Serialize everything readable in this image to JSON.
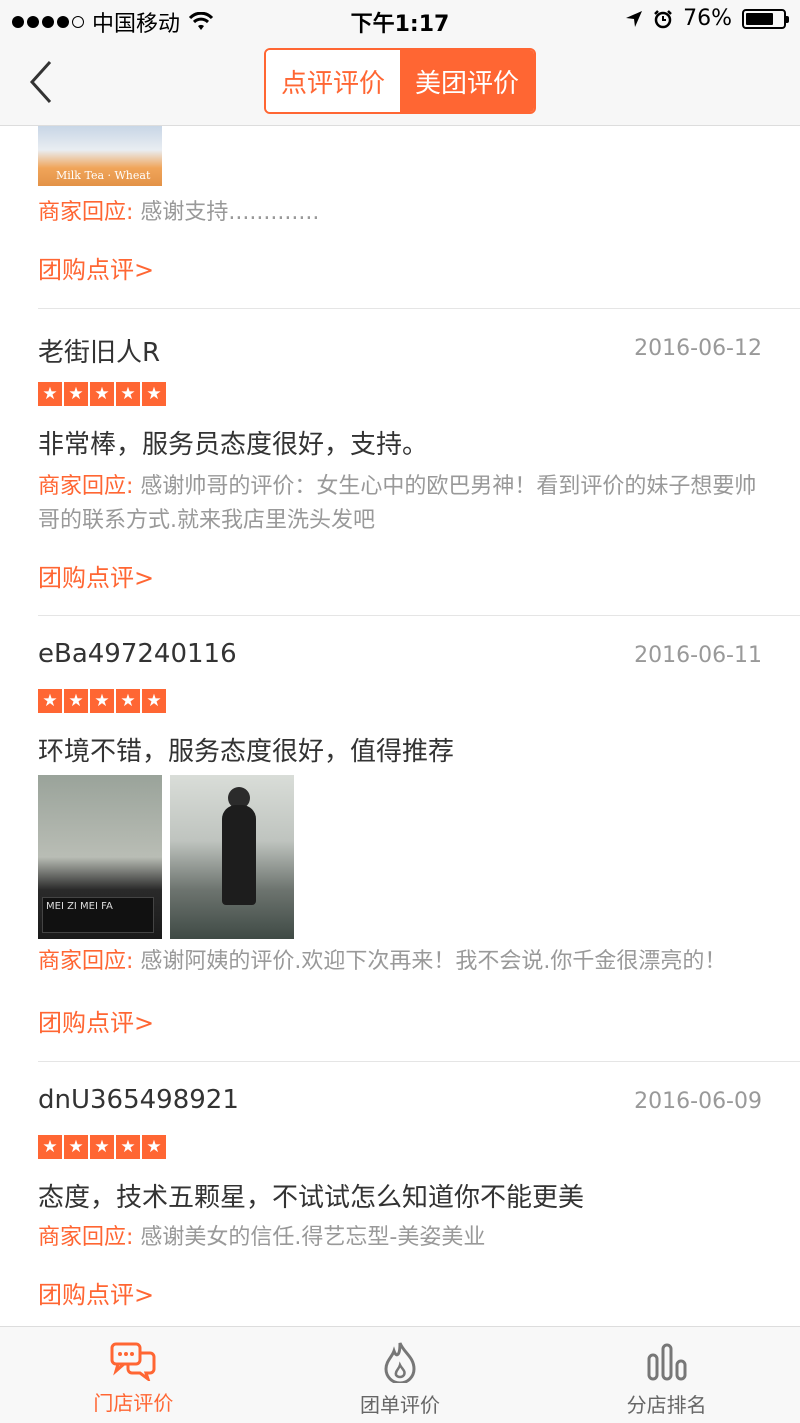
{
  "status_bar": {
    "carrier": "中国移动",
    "time": "下午1:17",
    "battery_percent": "76%",
    "battery_level": 0.76
  },
  "nav": {
    "back_icon": "chevron-left-icon",
    "segments": [
      {
        "label": "点评评价",
        "active": false
      },
      {
        "label": "美团评价",
        "active": true
      }
    ]
  },
  "previous_review": {
    "reply_label": "商家回应:",
    "reply_text": " 感谢支持.............",
    "link": "团购点评>"
  },
  "reviews": [
    {
      "user": "老街旧人R",
      "date": "2016-06-12",
      "rating": 5,
      "text": "非常棒，服务员态度很好，支持。",
      "reply_label": "商家回应:",
      "reply_text": " 感谢帅哥的评价：女生心中的欧巴男神！看到评价的妹子想要帅哥的联系方式.就来我店里洗头发吧",
      "link": "团购点评>"
    },
    {
      "user": "eBa497240116",
      "date": "2016-06-11",
      "rating": 5,
      "text": "环境不错，服务态度很好，值得推荐",
      "reply_label": "商家回应:",
      "reply_text": " 感谢阿姨的评价.欢迎下次再来！我不会说.你千金很漂亮的！",
      "link": "团购点评>"
    },
    {
      "user": "dnU365498921",
      "date": "2016-06-09",
      "rating": 5,
      "text": "态度，技术五颗星，不试试怎么知道你不能更美",
      "reply_label": "商家回应:",
      "reply_text": " 感谢美女的信任.得艺忘型-美姿美业",
      "link": "团购点评>"
    }
  ],
  "tabs": [
    {
      "label": "门店评价",
      "icon": "chat-bubbles-icon",
      "active": true
    },
    {
      "label": "团单评价",
      "icon": "flame-icon",
      "active": false
    },
    {
      "label": "分店排名",
      "icon": "bar-chart-icon",
      "active": false
    }
  ],
  "colors": {
    "accent": "#ff6633",
    "muted": "#999999",
    "text": "#333333"
  }
}
